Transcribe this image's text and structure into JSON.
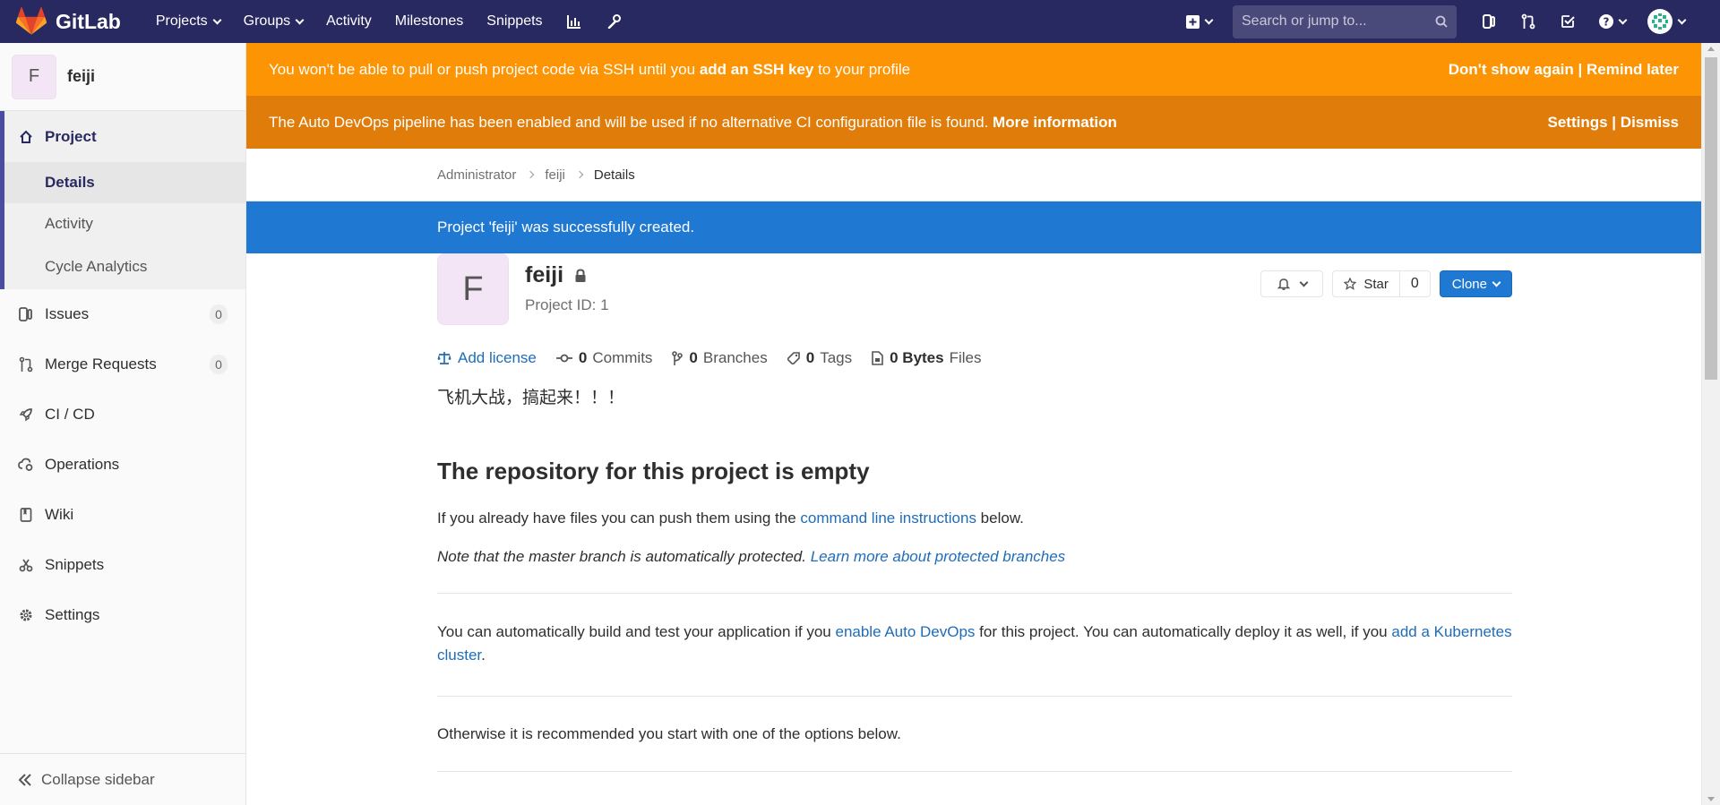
{
  "navbar": {
    "brand": "GitLab",
    "links": [
      "Projects",
      "Groups",
      "Activity",
      "Milestones",
      "Snippets"
    ],
    "search_placeholder": "Search or jump to..."
  },
  "sidebar": {
    "project_initial": "F",
    "project_name": "feiji",
    "project_label": "Project",
    "sub_items": [
      "Details",
      "Activity",
      "Cycle Analytics"
    ],
    "items": [
      {
        "label": "Issues",
        "count": "0"
      },
      {
        "label": "Merge Requests",
        "count": "0"
      },
      {
        "label": "CI / CD"
      },
      {
        "label": "Operations"
      },
      {
        "label": "Wiki"
      },
      {
        "label": "Snippets"
      },
      {
        "label": "Settings"
      }
    ],
    "collapse_label": "Collapse sidebar"
  },
  "banners": {
    "ssh": {
      "text_before": "You won't be able to pull or push project code via SSH until you ",
      "link": "add an SSH key",
      "text_after": " to your profile",
      "dont_show": "Don't show again",
      "sep": "|",
      "remind": "Remind later"
    },
    "devops": {
      "text": "The Auto DevOps pipeline has been enabled and will be used if no alternative CI configuration file is found.",
      "link": "More information",
      "settings": "Settings",
      "sep": "|",
      "dismiss": "Dismiss"
    }
  },
  "breadcrumb": [
    "Administrator",
    "feiji",
    "Details"
  ],
  "flash": "Project 'feiji' was successfully created.",
  "project": {
    "initial": "F",
    "name": "feiji",
    "id_text": "Project ID: 1",
    "star_label": "Star",
    "star_count": "0",
    "clone_label": "Clone",
    "stats": {
      "add_license": "Add license",
      "commits_count": "0",
      "commits_label": "Commits",
      "branches_count": "0",
      "branches_label": "Branches",
      "tags_count": "0",
      "tags_label": "Tags",
      "files_count": "0 Bytes",
      "files_label": "Files"
    },
    "description": "飞机大战，搞起来！！！"
  },
  "empty_repo": {
    "heading": "The repository for this project is empty",
    "push_text": "If you already have files you can push them using the ",
    "push_link": "command line instructions",
    "push_after": " below.",
    "note_text": "Note that the master branch is automatically protected. ",
    "note_link": "Learn more about protected branches",
    "devops_text1": "You can automatically build and test your application if you ",
    "devops_link1": "enable Auto DevOps",
    "devops_text2": " for this project. You can automatically deploy it as well, if you ",
    "devops_link2": "add a Kubernetes cluster",
    "devops_text3": ".",
    "otherwise": "Otherwise it is recommended you start with one of the options below."
  },
  "colors": {
    "navbar": "#292961",
    "banner_ssh": "#fc9403",
    "banner_devops": "#e07d0a",
    "flash": "#1f78d1",
    "link": "#1f6cb8"
  }
}
